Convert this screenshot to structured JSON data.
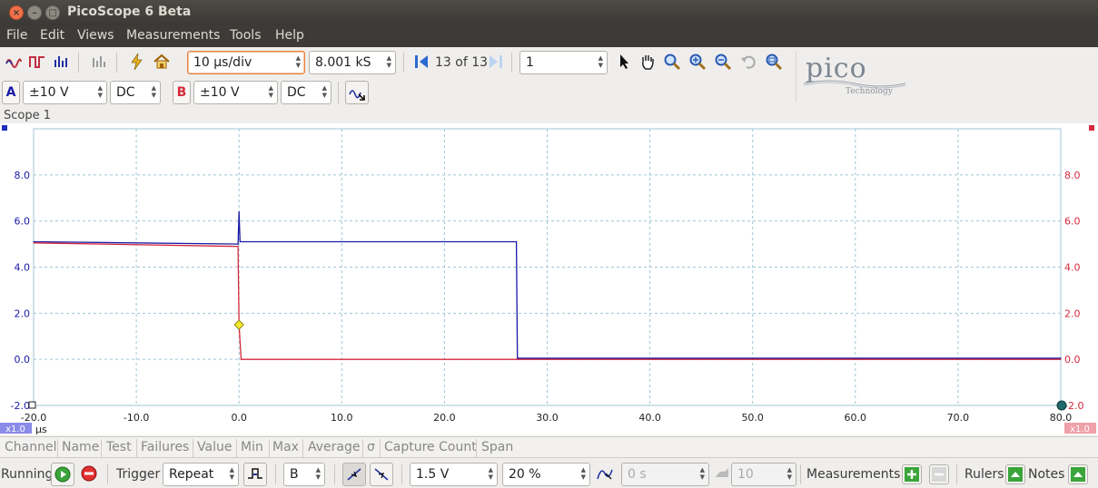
{
  "window": {
    "title": "PicoScope 6 Beta"
  },
  "menu": [
    "File",
    "Edit",
    "Views",
    "Measurements",
    "Tools",
    "Help"
  ],
  "toolbar": {
    "timebase": "10 µs/div",
    "samples": "8.001 kS",
    "buffer_nav": "13 of 13",
    "zoom_value": "1"
  },
  "channels": {
    "a": {
      "label": "A",
      "range": "±10 V",
      "coupling": "DC",
      "color": "#1a1aa6"
    },
    "b": {
      "label": "B",
      "range": "±10 V",
      "coupling": "DC",
      "color": "#d42a3a"
    }
  },
  "logo": {
    "word": "pico",
    "sub": "Technology"
  },
  "scope": {
    "title": "Scope 1",
    "x_unit": "µs",
    "left_scale": "x1.0",
    "right_scale": "x1.0",
    "left_ticks": [
      "8.0",
      "6.0",
      "4.0",
      "2.0",
      "0.0",
      "-2.0"
    ],
    "right_ticks": [
      "8.0",
      "6.0",
      "4.0",
      "2.0",
      "0.0",
      "-2.0"
    ],
    "x_ticks": [
      "-20.0",
      "-10.0",
      "0.0",
      "10.0",
      "20.0",
      "30.0",
      "40.0",
      "50.0",
      "60.0",
      "70.0",
      "80.0"
    ]
  },
  "chart_data": {
    "type": "line",
    "xlim": [
      -20,
      80
    ],
    "ylim": [
      -2,
      10
    ],
    "x_unit": "µs",
    "series": [
      {
        "color": "#1a1aa6",
        "x": [
          -20,
          -0.1,
          0,
          0.1,
          27,
          27.1,
          80
        ],
        "y": [
          5.1,
          5.0,
          6.4,
          5.1,
          5.1,
          0.05,
          0.05
        ]
      },
      {
        "color": "#d42a3a",
        "x": [
          -20,
          -0.5,
          -0.1,
          0,
          0.2,
          27,
          80
        ],
        "y": [
          5.05,
          4.9,
          4.9,
          1.5,
          0.0,
          0.0,
          0.0
        ]
      }
    ],
    "trigger": {
      "x": 0,
      "y": 1.5
    }
  },
  "measurements_header": [
    "Channel",
    "Name",
    "Test",
    "Failures",
    "Value",
    "Min",
    "Max",
    "Average",
    "σ",
    "Capture Count",
    "Span"
  ],
  "bottom": {
    "status": "Running",
    "trigger_label": "Trigger",
    "trigger_mode": "Repeat",
    "trigger_source": "B",
    "threshold": "1.5 V",
    "pretrigger": "20 %",
    "delay": "0 s",
    "count": "10",
    "measurements_label": "Measurements",
    "rulers_label": "Rulers",
    "notes_label": "Notes"
  }
}
